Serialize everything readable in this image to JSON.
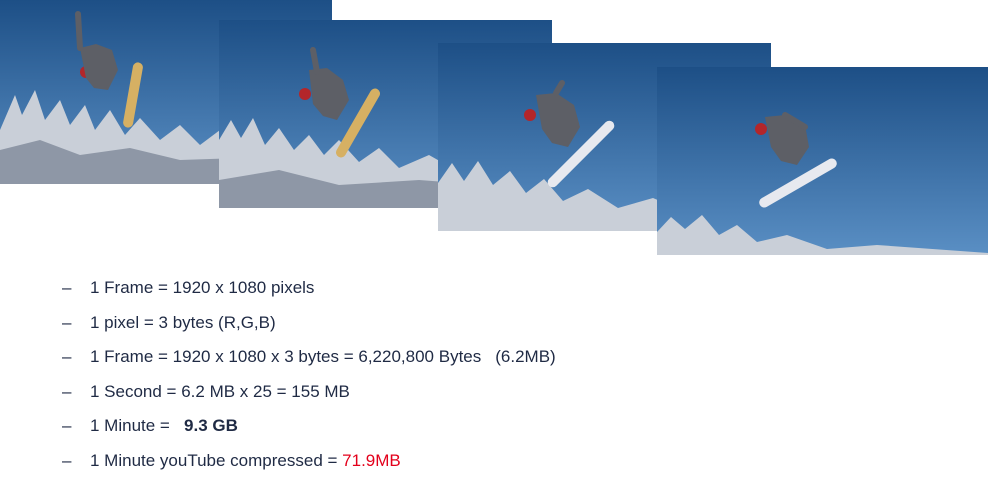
{
  "frames": [
    {
      "alt_icon": "snowboarder-frame-1-image"
    },
    {
      "alt_icon": "snowboarder-frame-2-image"
    },
    {
      "alt_icon": "snowboarder-frame-3-image"
    },
    {
      "alt_icon": "snowboarder-frame-4-image"
    }
  ],
  "colors": {
    "sky_top": "#1d4f86",
    "sky_bottom": "#4f86bf",
    "trees": "#c9cfd8",
    "text": "#1f2a44",
    "highlight": "#e3001b"
  },
  "bullets": {
    "dash": "–",
    "b1": "1 Frame = 1920 x 1080 pixels",
    "b2": "1 pixel = 3 bytes (R,G,B)",
    "b3_main": "1 Frame = 1920 x 1080 x 3 bytes = 6,220,800 Bytes",
    "b3_paren": "(6.2MB)",
    "b4": "1 Second = 6.2 MB x 25 = 155 MB",
    "b5_label": "1 Minute =",
    "b5_value": "9.3 GB",
    "b6_label": "1 Minute youTube compressed =",
    "b6_value": "71.9MB"
  }
}
